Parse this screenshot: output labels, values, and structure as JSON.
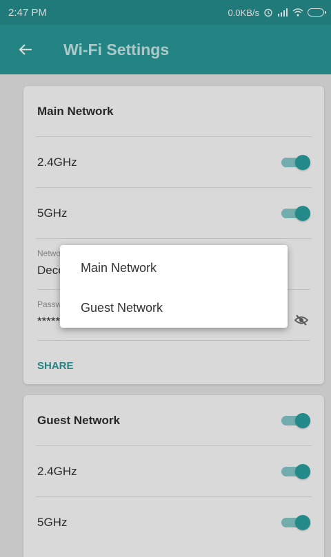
{
  "status_bar": {
    "time": "2:47 PM",
    "speed": "0.0KB/s"
  },
  "toolbar": {
    "title": "Wi‑Fi Settings"
  },
  "main_network": {
    "title": "Main Network",
    "band_24": "2.4GHz",
    "band_5": "5GHz",
    "network_name_label": "Network Name",
    "network_name_value": "Deco",
    "password_label": "Password",
    "password_value": "********",
    "share_label": "SHARE"
  },
  "guest_network": {
    "title": "Guest Network",
    "band_24": "2.4GHz",
    "band_5": "5GHz"
  },
  "popup_menu": {
    "items": [
      "Main Network",
      "Guest Network"
    ]
  },
  "colors": {
    "accent": "#2a9c9b",
    "statusbar": "#26908f"
  }
}
